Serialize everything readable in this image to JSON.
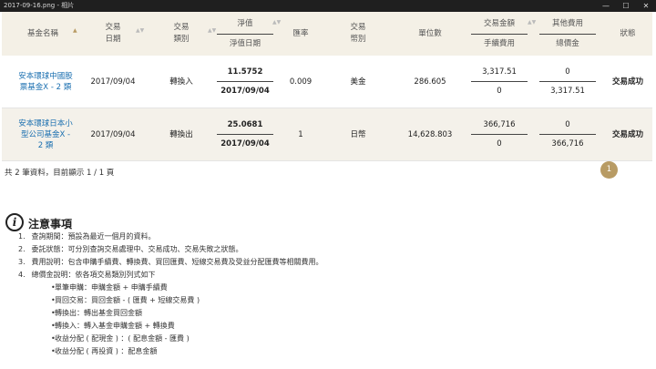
{
  "window": {
    "title": "2017-09-16.png - 相片",
    "minimize": "—",
    "maximize": "☐",
    "close": "✕"
  },
  "table": {
    "headers": {
      "fund_name": "基金名稱",
      "trade_date_1": "交易",
      "trade_date_2": "日期",
      "trade_type_1": "交易",
      "trade_type_2": "類別",
      "nav_top": "淨值",
      "nav_bottom": "淨值日期",
      "rate": "匯率",
      "currency_1": "交易",
      "currency_2": "幣別",
      "units": "單位數",
      "amount_top": "交易金額",
      "amount_bottom": "手續費用",
      "fee_top": "其他費用",
      "fee_bottom": "總價金",
      "status": "狀態"
    },
    "rows": [
      {
        "fund_name_l1": "安本環球中國股",
        "fund_name_l2": "票基金X - 2 類",
        "trade_date": "2017/09/04",
        "trade_type": "轉換入",
        "nav": "11.5752",
        "nav_date": "2017/09/04",
        "rate": "0.009",
        "currency": "美金",
        "units": "286.605",
        "amount": "3,317.51",
        "handling_fee": "0",
        "other_fee": "0",
        "total": "3,317.51",
        "status": "交易成功"
      },
      {
        "fund_name_l1": "安本環球日本小",
        "fund_name_l2": "型公司基金X -",
        "fund_name_l3": "2 類",
        "trade_date": "2017/09/04",
        "trade_type": "轉換出",
        "nav": "25.0681",
        "nav_date": "2017/09/04",
        "rate": "1",
        "currency": "日幣",
        "units": "14,628.803",
        "amount": "366,716",
        "handling_fee": "0",
        "other_fee": "0",
        "total": "366,716",
        "status": "交易成功"
      }
    ]
  },
  "pagination": {
    "summary": "共 2 筆資料，目前顯示 1 / 1 頁",
    "current_page": "1"
  },
  "notice": {
    "icon": "i",
    "title": "注意事項",
    "items": [
      {
        "num": "1.",
        "text": "查詢期間：預設為最近一個月的資料。"
      },
      {
        "num": "2.",
        "text": "委託狀態：可分別查詢交易處理中、交易成功、交易失敗之狀態。"
      },
      {
        "num": "3.",
        "text": "費用說明：包含申購手續費、轉換費、買回匯費、短線交易費及受益分配匯費等相關費用。"
      },
      {
        "num": "4.",
        "text": "總價金說明：依各項交易類別列式如下"
      }
    ],
    "sub_items": [
      "單筆申購：申購金額 + 申購手續費",
      "買回交易：買回金額 - ( 匯費 + 短線交易費 )",
      "轉換出：轉出基金買回金額",
      "轉換入：轉入基金申購金額 + 轉換費",
      "收益分配 ( 配現金 ) ：( 配息金額 - 匯費 )",
      "收益分配 ( 再投資 ) ：配息金額"
    ]
  },
  "colors": {
    "header_bg": "#f4f0e6",
    "accent_gold": "#b89b64",
    "link_blue": "#1a6fb0",
    "titlebar_bg": "#1f1f1f"
  }
}
